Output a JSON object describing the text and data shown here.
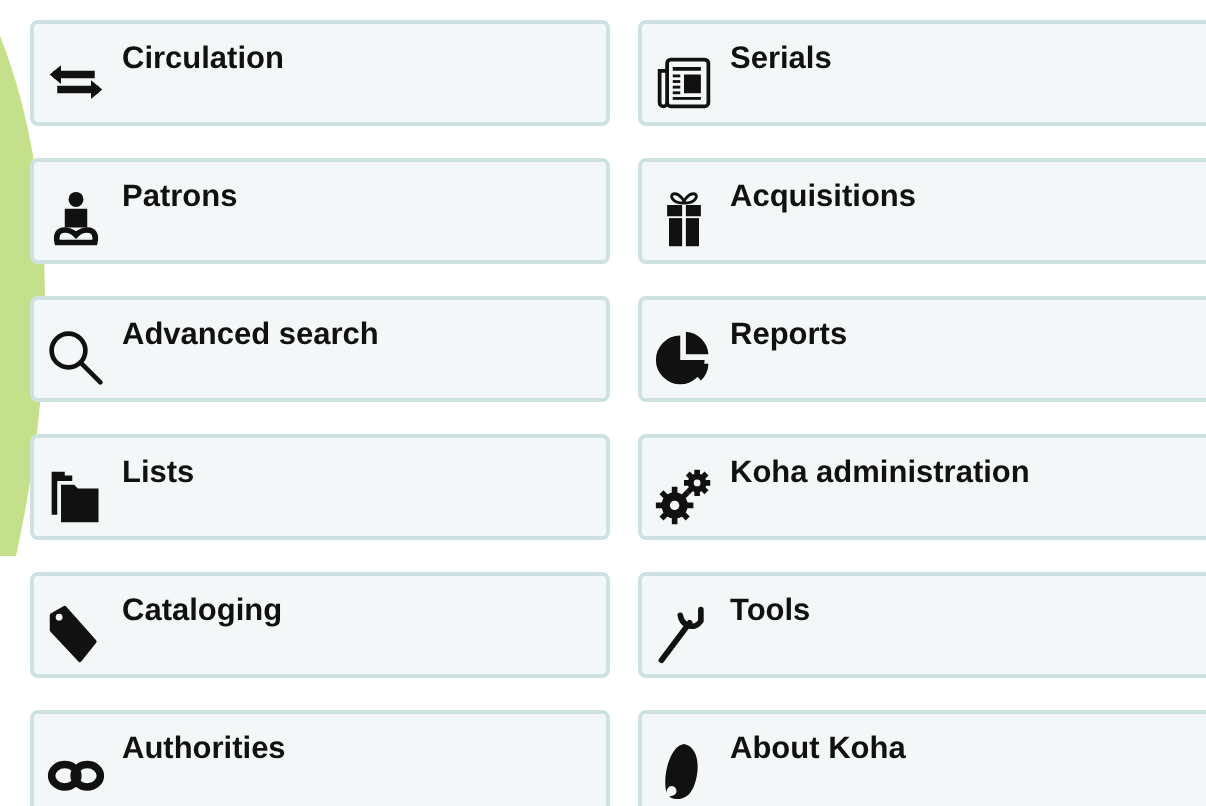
{
  "modules": [
    {
      "label": "Circulation"
    },
    {
      "label": "Serials"
    },
    {
      "label": "Patrons"
    },
    {
      "label": "Acquisitions"
    },
    {
      "label": "Advanced search"
    },
    {
      "label": "Reports"
    },
    {
      "label": "Lists"
    },
    {
      "label": "Koha administration"
    },
    {
      "label": "Cataloging"
    },
    {
      "label": "Tools"
    },
    {
      "label": "Authorities"
    },
    {
      "label": "About Koha"
    }
  ]
}
